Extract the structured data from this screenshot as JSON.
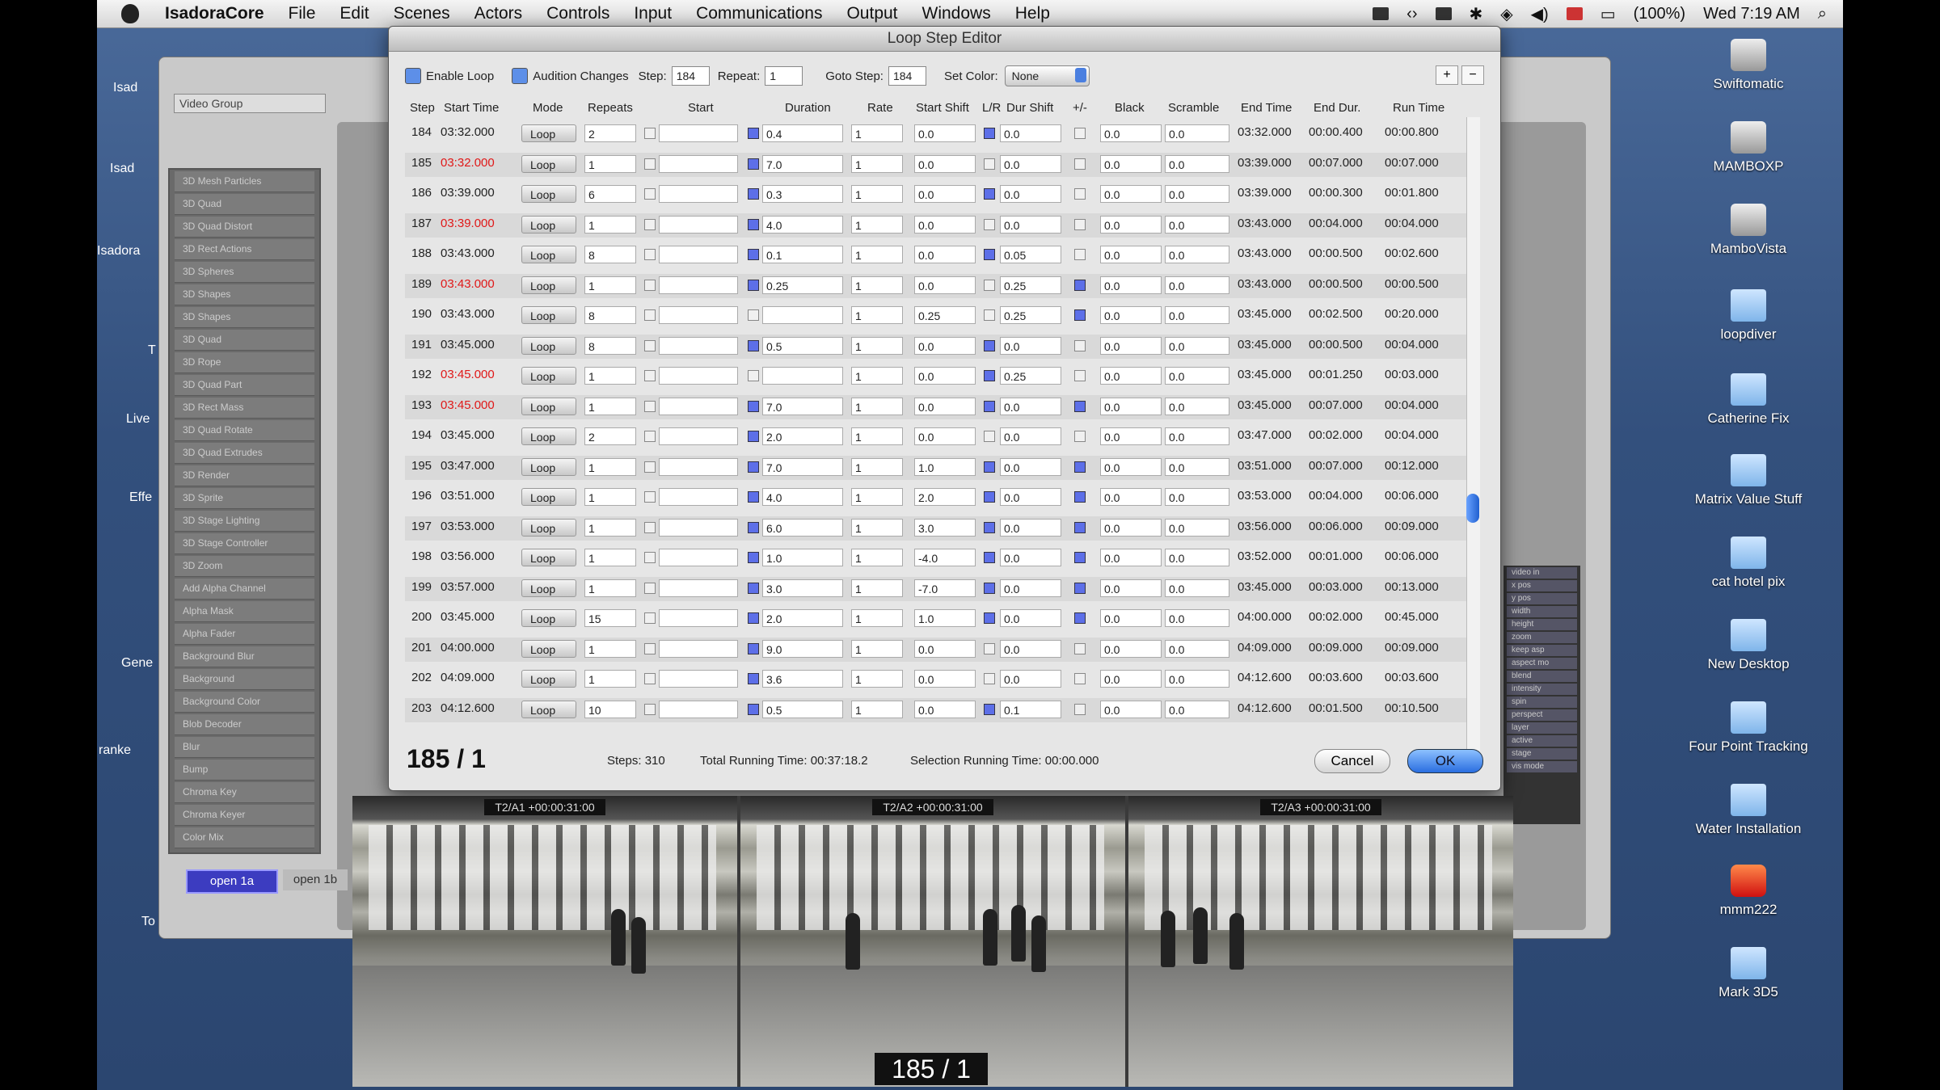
{
  "menubar": {
    "app": "IsadoraCore",
    "items": [
      "File",
      "Edit",
      "Scenes",
      "Actors",
      "Controls",
      "Input",
      "Communications",
      "Output",
      "Windows",
      "Help"
    ],
    "battery": "(100%)",
    "clock": "Wed 7:19 AM"
  },
  "desktop_icons": [
    "Swiftomatic",
    "MAMBOXP",
    "MamboVista",
    "loopdiver",
    "Catherine Fix",
    "Matrix Value Stuff",
    "cat hotel pix",
    "New Desktop",
    "Four Point Tracking",
    "Water Installation",
    "mmm222",
    "Mark 3D5"
  ],
  "left_labels": [
    "Isad",
    "Isad",
    "Isadora",
    "T",
    "Live",
    "Effe",
    "Gene",
    "ranke",
    "To"
  ],
  "bg_window": {
    "group_label": "Video Group",
    "scene_tabs": [
      "open 1a",
      "open 1b"
    ],
    "sidebar_items": [
      "3D Mesh Particles",
      "3D Quad",
      "3D Quad Distort",
      "3D Rect Actions",
      "3D Spheres",
      "3D Shapes",
      "3D Shapes",
      "3D Quad",
      "3D Rope",
      "3D Quad Part",
      "3D Rect Mass",
      "3D Quad Rotate",
      "3D Quad Extrudes",
      "3D Render",
      "3D Sprite",
      "3D Stage Lighting",
      "3D Stage Controller",
      "3D Zoom",
      "Add Alpha Channel",
      "Alpha Mask",
      "Alpha Fader",
      "Background Blur",
      "Background",
      "Background Color",
      "Blob Decoder",
      "Blur",
      "Bump",
      "Chroma Key",
      "Chroma Keyer",
      "Color Mix"
    ],
    "right_panel_items": [
      "video in",
      "x pos",
      "y pos",
      "width",
      "height",
      "zoom",
      "keep asp",
      "aspect mo",
      "blend",
      "intensity",
      "spin",
      "perspect",
      "layer",
      "active",
      "stage",
      "vis mode"
    ]
  },
  "dialog": {
    "title": "Loop Step Editor",
    "toolbar": {
      "enable_loop": "Enable Loop",
      "audition_changes": "Audition Changes",
      "step_label": "Step:",
      "step_value": "184",
      "repeat_label": "Repeat:",
      "repeat_value": "1",
      "goto_label": "Goto Step:",
      "goto_value": "184",
      "set_color_label": "Set Color:",
      "set_color_value": "None",
      "plus": "+",
      "minus": "−"
    },
    "columns": [
      "Step",
      "Start Time",
      "Mode",
      "Repeats",
      "Start",
      "Duration",
      "Rate",
      "Start Shift",
      "L/R",
      "Dur Shift",
      "+/-",
      "Black",
      "Scramble",
      "End Time",
      "End Dur.",
      "Run Time"
    ],
    "rows": [
      {
        "step": "184",
        "start_time": "03:32.000",
        "red": false,
        "mode": "Loop",
        "repeats": "2",
        "c1": false,
        "c2": true,
        "duration": "0.4",
        "rate": "1",
        "start_shift": "0.0",
        "lr": true,
        "dur_shift": "0.0",
        "pm": false,
        "black": "0.0",
        "scramble": "0.0",
        "end_time": "03:32.000",
        "end_dur": "00:00.400",
        "run_time": "00:00.800"
      },
      {
        "step": "185",
        "start_time": "03:32.000",
        "red": true,
        "mode": "Loop",
        "repeats": "1",
        "c1": false,
        "c2": true,
        "duration": "7.0",
        "rate": "1",
        "start_shift": "0.0",
        "lr": false,
        "dur_shift": "0.0",
        "pm": false,
        "black": "0.0",
        "scramble": "0.0",
        "end_time": "03:39.000",
        "end_dur": "00:07.000",
        "run_time": "00:07.000"
      },
      {
        "step": "186",
        "start_time": "03:39.000",
        "red": false,
        "mode": "Loop",
        "repeats": "6",
        "c1": false,
        "c2": true,
        "duration": "0.3",
        "rate": "1",
        "start_shift": "0.0",
        "lr": true,
        "dur_shift": "0.0",
        "pm": false,
        "black": "0.0",
        "scramble": "0.0",
        "end_time": "03:39.000",
        "end_dur": "00:00.300",
        "run_time": "00:01.800"
      },
      {
        "step": "187",
        "start_time": "03:39.000",
        "red": true,
        "mode": "Loop",
        "repeats": "1",
        "c1": false,
        "c2": true,
        "duration": "4.0",
        "rate": "1",
        "start_shift": "0.0",
        "lr": false,
        "dur_shift": "0.0",
        "pm": false,
        "black": "0.0",
        "scramble": "0.0",
        "end_time": "03:43.000",
        "end_dur": "00:04.000",
        "run_time": "00:04.000"
      },
      {
        "step": "188",
        "start_time": "03:43.000",
        "red": false,
        "mode": "Loop",
        "repeats": "8",
        "c1": false,
        "c2": true,
        "duration": "0.1",
        "rate": "1",
        "start_shift": "0.0",
        "lr": true,
        "dur_shift": "0.05",
        "pm": false,
        "black": "0.0",
        "scramble": "0.0",
        "end_time": "03:43.000",
        "end_dur": "00:00.500",
        "run_time": "00:02.600"
      },
      {
        "step": "189",
        "start_time": "03:43.000",
        "red": true,
        "mode": "Loop",
        "repeats": "1",
        "c1": false,
        "c2": true,
        "duration": "0.25",
        "rate": "1",
        "start_shift": "0.0",
        "lr": false,
        "dur_shift": "0.25",
        "pm": true,
        "black": "0.0",
        "scramble": "0.0",
        "end_time": "03:43.000",
        "end_dur": "00:00.500",
        "run_time": "00:00.500"
      },
      {
        "step": "190",
        "start_time": "03:43.000",
        "red": false,
        "mode": "Loop",
        "repeats": "8",
        "c1": false,
        "c2": false,
        "duration": "",
        "rate": "1",
        "start_shift": "0.25",
        "lr": false,
        "dur_shift": "0.25",
        "pm": true,
        "black": "0.0",
        "scramble": "0.0",
        "end_time": "03:45.000",
        "end_dur": "00:02.500",
        "run_time": "00:20.000"
      },
      {
        "step": "191",
        "start_time": "03:45.000",
        "red": false,
        "mode": "Loop",
        "repeats": "8",
        "c1": false,
        "c2": true,
        "duration": "0.5",
        "rate": "1",
        "start_shift": "0.0",
        "lr": true,
        "dur_shift": "0.0",
        "pm": false,
        "black": "0.0",
        "scramble": "0.0",
        "end_time": "03:45.000",
        "end_dur": "00:00.500",
        "run_time": "00:04.000"
      },
      {
        "step": "192",
        "start_time": "03:45.000",
        "red": true,
        "mode": "Loop",
        "repeats": "1",
        "c1": false,
        "c2": false,
        "duration": "",
        "rate": "1",
        "start_shift": "0.0",
        "lr": true,
        "dur_shift": "0.25",
        "pm": false,
        "black": "0.0",
        "scramble": "0.0",
        "end_time": "03:45.000",
        "end_dur": "00:01.250",
        "run_time": "00:03.000"
      },
      {
        "step": "193",
        "start_time": "03:45.000",
        "red": true,
        "mode": "Loop",
        "repeats": "1",
        "c1": false,
        "c2": true,
        "duration": "7.0",
        "rate": "1",
        "start_shift": "0.0",
        "lr": true,
        "dur_shift": "0.0",
        "pm": true,
        "black": "0.0",
        "scramble": "0.0",
        "end_time": "03:45.000",
        "end_dur": "00:07.000",
        "run_time": "00:04.000"
      },
      {
        "step": "194",
        "start_time": "03:45.000",
        "red": false,
        "mode": "Loop",
        "repeats": "2",
        "c1": false,
        "c2": true,
        "duration": "2.0",
        "rate": "1",
        "start_shift": "0.0",
        "lr": false,
        "dur_shift": "0.0",
        "pm": false,
        "black": "0.0",
        "scramble": "0.0",
        "end_time": "03:47.000",
        "end_dur": "00:02.000",
        "run_time": "00:04.000"
      },
      {
        "step": "195",
        "start_time": "03:47.000",
        "red": false,
        "mode": "Loop",
        "repeats": "1",
        "c1": false,
        "c2": true,
        "duration": "7.0",
        "rate": "1",
        "start_shift": "1.0",
        "lr": true,
        "dur_shift": "0.0",
        "pm": true,
        "black": "0.0",
        "scramble": "0.0",
        "end_time": "03:51.000",
        "end_dur": "00:07.000",
        "run_time": "00:12.000"
      },
      {
        "step": "196",
        "start_time": "03:51.000",
        "red": false,
        "mode": "Loop",
        "repeats": "1",
        "c1": false,
        "c2": true,
        "duration": "4.0",
        "rate": "1",
        "start_shift": "2.0",
        "lr": true,
        "dur_shift": "0.0",
        "pm": true,
        "black": "0.0",
        "scramble": "0.0",
        "end_time": "03:53.000",
        "end_dur": "00:04.000",
        "run_time": "00:06.000"
      },
      {
        "step": "197",
        "start_time": "03:53.000",
        "red": false,
        "mode": "Loop",
        "repeats": "1",
        "c1": false,
        "c2": true,
        "duration": "6.0",
        "rate": "1",
        "start_shift": "3.0",
        "lr": true,
        "dur_shift": "0.0",
        "pm": true,
        "black": "0.0",
        "scramble": "0.0",
        "end_time": "03:56.000",
        "end_dur": "00:06.000",
        "run_time": "00:09.000"
      },
      {
        "step": "198",
        "start_time": "03:56.000",
        "red": false,
        "mode": "Loop",
        "repeats": "1",
        "c1": false,
        "c2": true,
        "duration": "1.0",
        "rate": "1",
        "start_shift": "-4.0",
        "lr": true,
        "dur_shift": "0.0",
        "pm": true,
        "black": "0.0",
        "scramble": "0.0",
        "end_time": "03:52.000",
        "end_dur": "00:01.000",
        "run_time": "00:06.000"
      },
      {
        "step": "199",
        "start_time": "03:57.000",
        "red": false,
        "mode": "Loop",
        "repeats": "1",
        "c1": false,
        "c2": true,
        "duration": "3.0",
        "rate": "1",
        "start_shift": "-7.0",
        "lr": true,
        "dur_shift": "0.0",
        "pm": true,
        "black": "0.0",
        "scramble": "0.0",
        "end_time": "03:45.000",
        "end_dur": "00:03.000",
        "run_time": "00:13.000"
      },
      {
        "step": "200",
        "start_time": "03:45.000",
        "red": false,
        "mode": "Loop",
        "repeats": "15",
        "c1": false,
        "c2": true,
        "duration": "2.0",
        "rate": "1",
        "start_shift": "1.0",
        "lr": true,
        "dur_shift": "0.0",
        "pm": true,
        "black": "0.0",
        "scramble": "0.0",
        "end_time": "04:00.000",
        "end_dur": "00:02.000",
        "run_time": "00:45.000"
      },
      {
        "step": "201",
        "start_time": "04:00.000",
        "red": false,
        "mode": "Loop",
        "repeats": "1",
        "c1": false,
        "c2": true,
        "duration": "9.0",
        "rate": "1",
        "start_shift": "0.0",
        "lr": false,
        "dur_shift": "0.0",
        "pm": false,
        "black": "0.0",
        "scramble": "0.0",
        "end_time": "04:09.000",
        "end_dur": "00:09.000",
        "run_time": "00:09.000"
      },
      {
        "step": "202",
        "start_time": "04:09.000",
        "red": false,
        "mode": "Loop",
        "repeats": "1",
        "c1": false,
        "c2": true,
        "duration": "3.6",
        "rate": "1",
        "start_shift": "0.0",
        "lr": false,
        "dur_shift": "0.0",
        "pm": false,
        "black": "0.0",
        "scramble": "0.0",
        "end_time": "04:12.600",
        "end_dur": "00:03.600",
        "run_time": "00:03.600"
      },
      {
        "step": "203",
        "start_time": "04:12.600",
        "red": false,
        "mode": "Loop",
        "repeats": "10",
        "c1": false,
        "c2": true,
        "duration": "0.5",
        "rate": "1",
        "start_shift": "0.0",
        "lr": true,
        "dur_shift": "0.1",
        "pm": false,
        "black": "0.0",
        "scramble": "0.0",
        "end_time": "04:12.600",
        "end_dur": "00:01.500",
        "run_time": "00:10.500"
      }
    ],
    "footer": {
      "position": "185 / 1",
      "steps": "Steps: 310",
      "total_running": "Total Running Time: 00:37:18.2",
      "selection_running": "Selection Running Time: 00:00.000",
      "cancel": "Cancel",
      "ok": "OK"
    }
  },
  "video": {
    "labels": [
      "T2/A1 +00:00:31:00",
      "T2/A2 +00:00:31:00",
      "T2/A3 +00:00:31:00"
    ],
    "counter": "185 / 1"
  },
  "colors": {
    "red_time": "#e01818",
    "accent_blue": "#2a6ee0"
  }
}
